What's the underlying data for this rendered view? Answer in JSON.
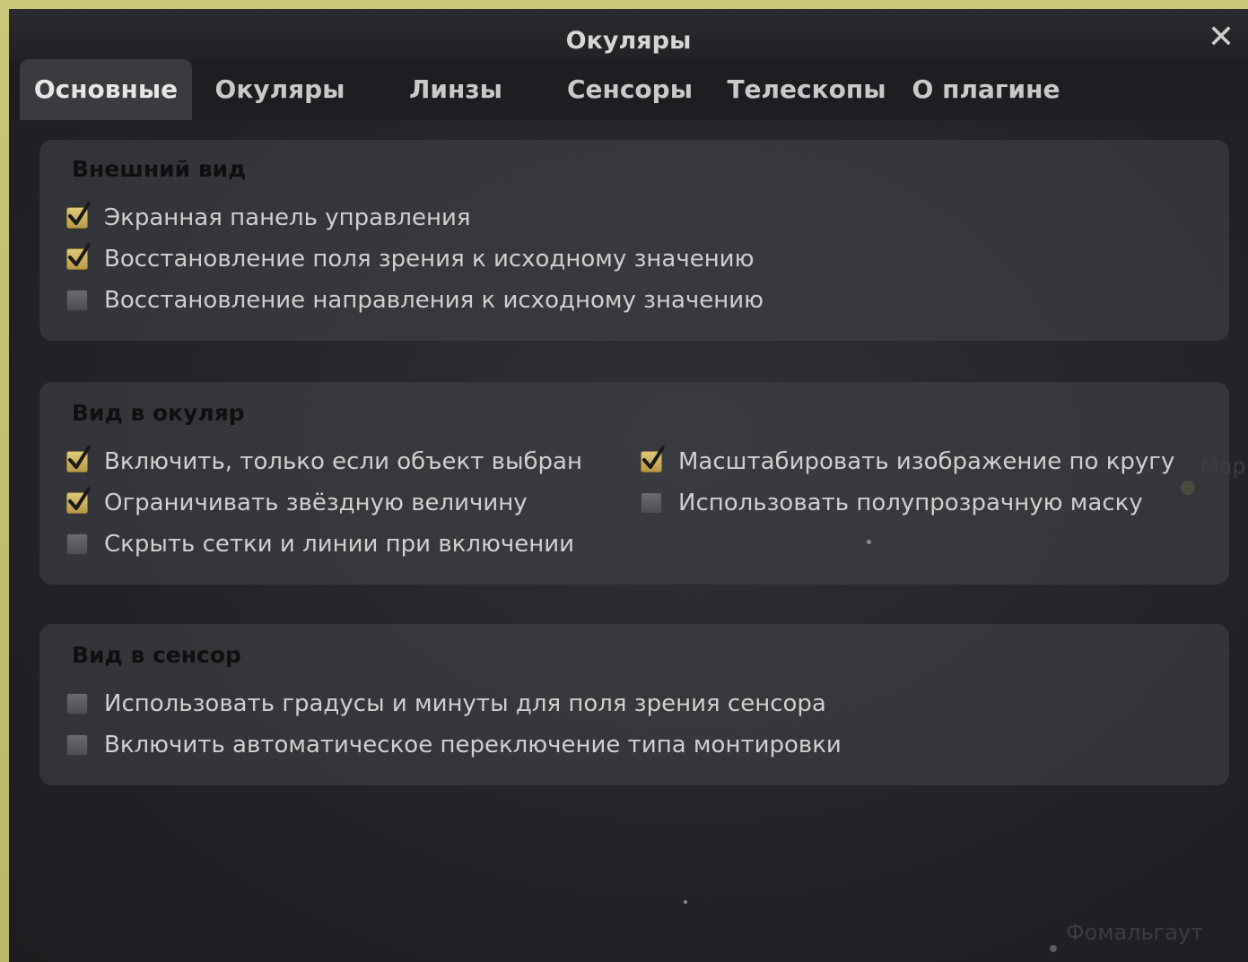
{
  "window": {
    "title": "Окуляры",
    "close_label": "✕"
  },
  "tabs": [
    {
      "label": "Основные",
      "active": true
    },
    {
      "label": "Окуляры",
      "active": false
    },
    {
      "label": "Линзы",
      "active": false
    },
    {
      "label": "Сенсоры",
      "active": false
    },
    {
      "label": "Телескопы",
      "active": false
    },
    {
      "label": "О плагине",
      "active": false
    }
  ],
  "groups": {
    "appearance": {
      "title": "Внешний вид",
      "options": [
        {
          "label": "Экранная панель управления",
          "checked": true
        },
        {
          "label": "Восстановление поля зрения к исходному значению",
          "checked": true
        },
        {
          "label": "Восстановление направления к исходному значению",
          "checked": false
        }
      ]
    },
    "eyepiece_view": {
      "title": "Вид в окуляр",
      "options": [
        {
          "label": "Включить, только если объект выбран",
          "checked": true
        },
        {
          "label": "Ограничивать звёздную величину",
          "checked": true
        },
        {
          "label": "Скрыть сетки и линии при включении",
          "checked": false
        },
        {
          "label": "Масштабировать изображение по кругу",
          "checked": true
        },
        {
          "label": "Использовать полупрозрачную маску",
          "checked": false
        }
      ]
    },
    "sensor_view": {
      "title": "Вид в сенсор",
      "options": [
        {
          "label": "Использовать градусы и минуты для поля зрения сенсора",
          "checked": false
        },
        {
          "label": "Включить автоматическое переключение типа монтировки",
          "checked": false
        }
      ]
    }
  },
  "background": {
    "star_label": "Фомальгаут",
    "edge_label": "Мар"
  },
  "colors": {
    "accent": "#d8bf6a",
    "window_bg": "#242529",
    "text": "#cfcfcf"
  }
}
